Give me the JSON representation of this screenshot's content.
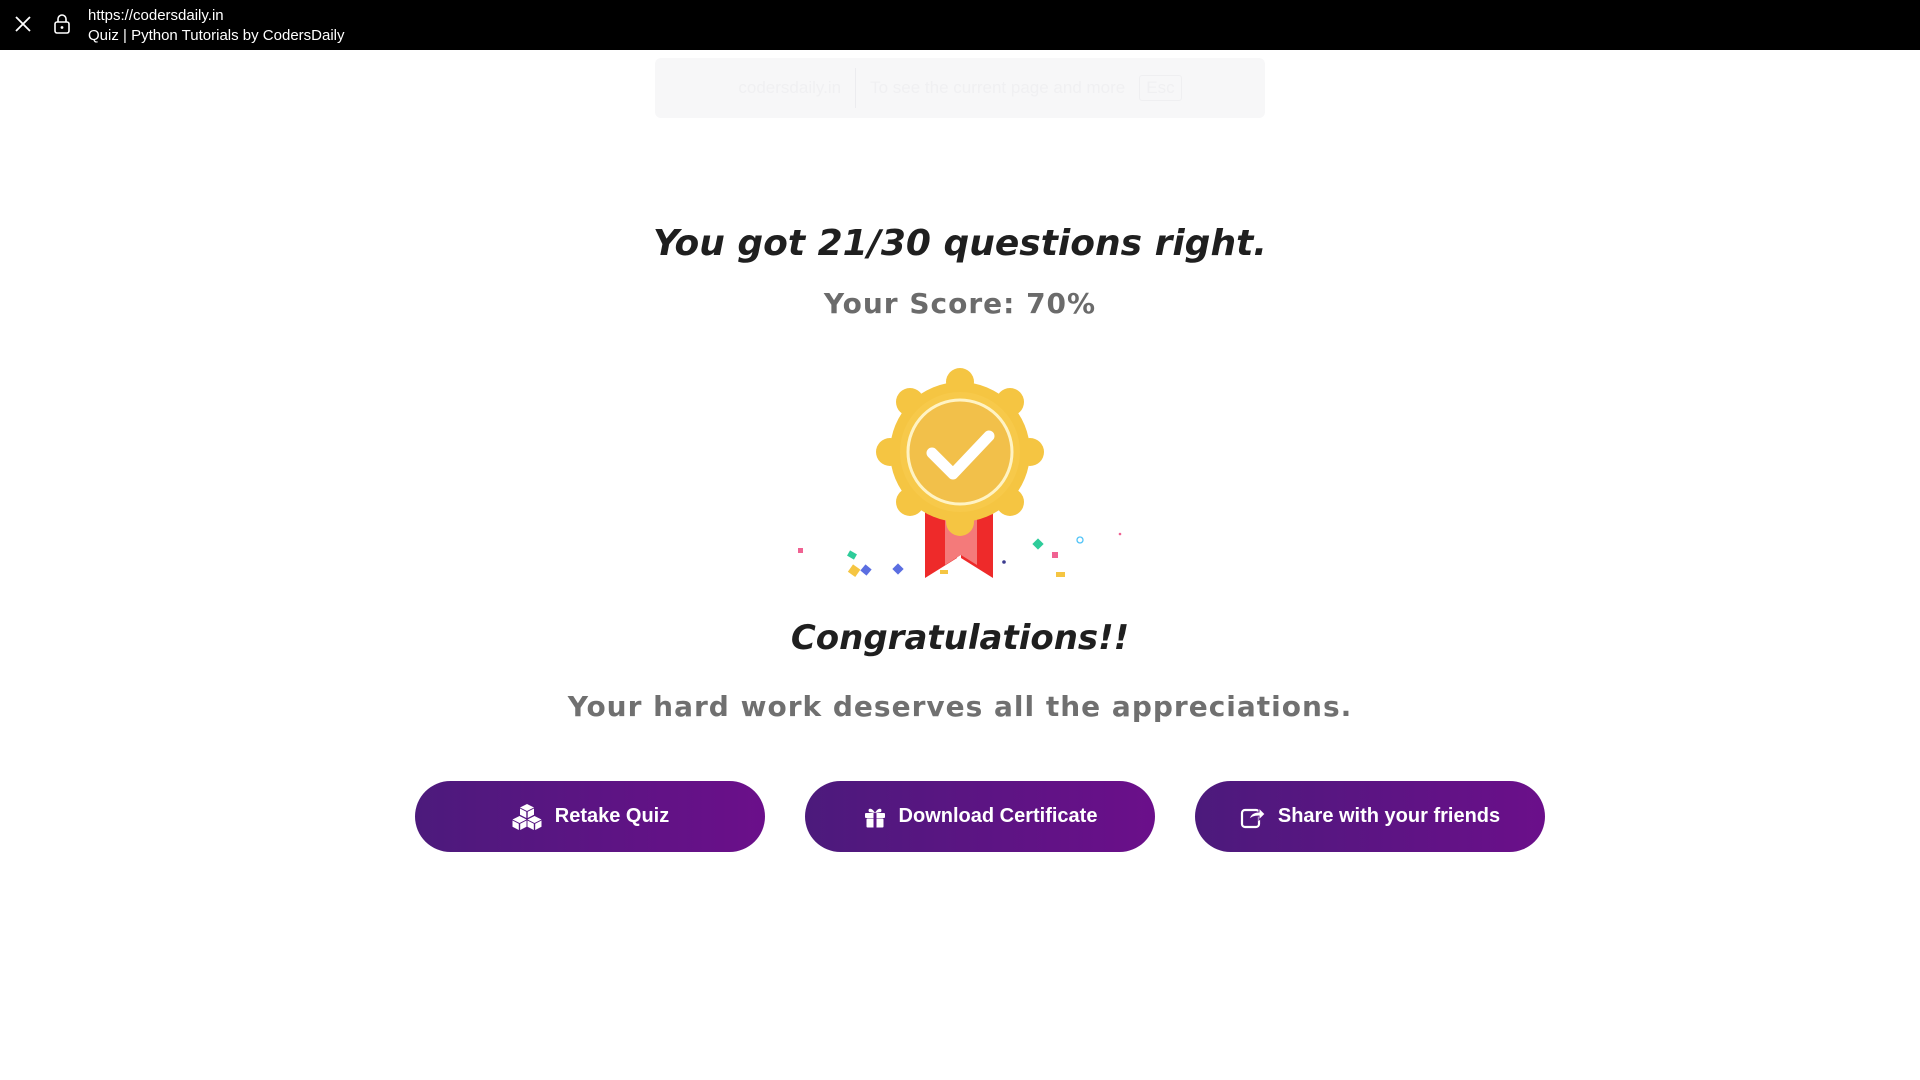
{
  "browser": {
    "url": "https://codersdaily.in",
    "page_title": "Quiz | Python Tutorials by CodersDaily"
  },
  "banner": {
    "site": "codersdaily.in",
    "message": "To see the current page and more",
    "close_label": "Esc"
  },
  "result": {
    "headline": "You got 21/30 questions right.",
    "score_text": "Your Score: 70%",
    "correct": 21,
    "total": 30,
    "score_percent": 70
  },
  "message": {
    "title": "Congratulations!!",
    "subtitle": "Your hard work deserves all the appreciations."
  },
  "actions": {
    "retake_label": "Retake Quiz",
    "retake_icon": "cubes-icon",
    "download_label": "Download Certificate",
    "download_icon": "gift-icon",
    "share_label": "Share with your friends",
    "share_icon": "share-icon"
  },
  "colors": {
    "button_gradient_start": "#4c1a7c",
    "button_gradient_end": "#6b0f8a",
    "medal_gold": "#f5c542",
    "ribbon_red": "#ee2a2a"
  }
}
